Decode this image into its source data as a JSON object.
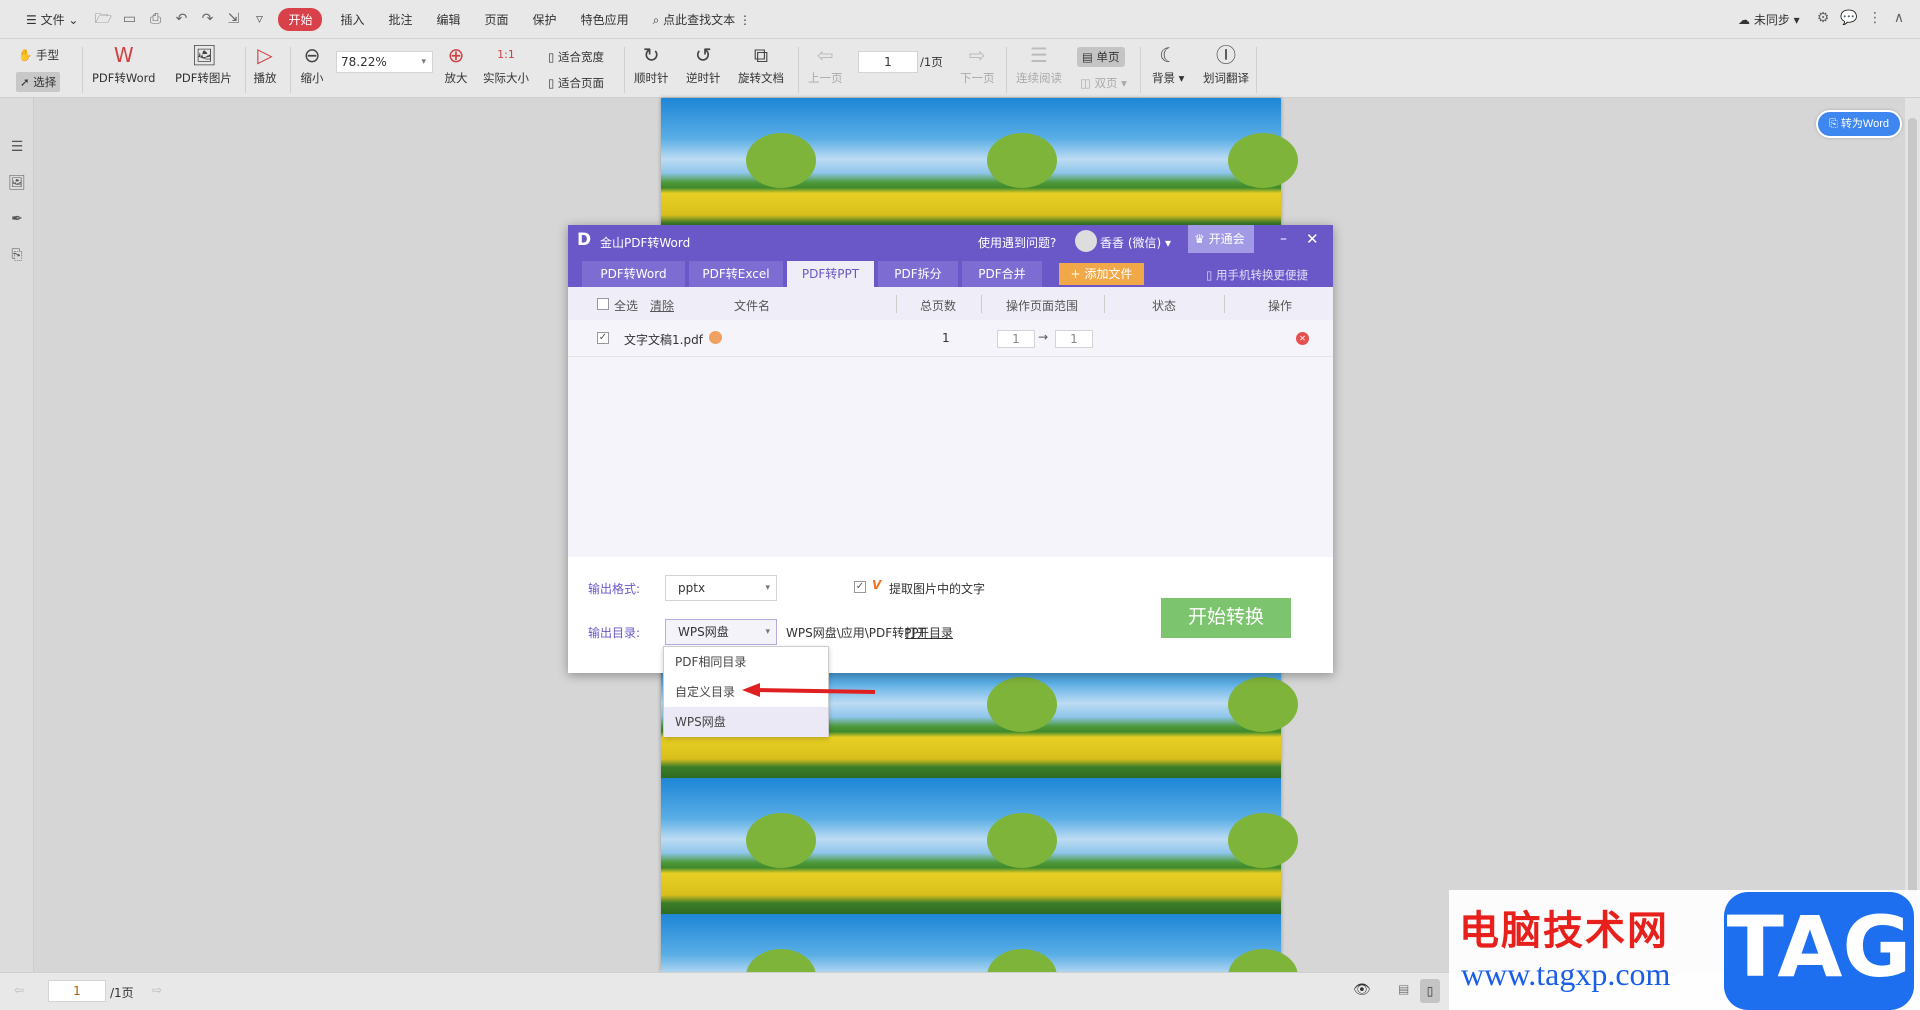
{
  "menubar": {
    "file": "文件",
    "start": "开始",
    "items": [
      "插入",
      "批注",
      "编辑",
      "页面",
      "保护",
      "特色应用"
    ],
    "search": "点此查找文本",
    "sync": "未同步"
  },
  "toolbar": {
    "hand": "手型",
    "select": "选择",
    "pdf_to_word": "PDF转Word",
    "pdf_to_image": "PDF转图片",
    "play": "播放",
    "zoom_out": "缩小",
    "zoom_value": "78.22%",
    "zoom_in": "放大",
    "actual_size": "实际大小",
    "fit_width": "适合宽度",
    "fit_page": "适合页面",
    "clockwise": "顺时针",
    "counter_clockwise": "逆时针",
    "rotate_doc": "旋转文档",
    "prev_page": "上一页",
    "page_input": "1",
    "page_total": "/1页",
    "next_page": "下一页",
    "continuous": "连续阅读",
    "single": "单页",
    "double": "双页",
    "background": "背景",
    "translate": "划词翻译"
  },
  "convert_word_button": "转为Word",
  "dialog": {
    "title": "金山PDF转Word",
    "help": "使用遇到问题?",
    "user": "香香 (微信)",
    "vip": "开通会员",
    "tabs": [
      "PDF转Word",
      "PDF转Excel",
      "PDF转PPT",
      "PDF拆分",
      "PDF合并"
    ],
    "add_file": "添加文件",
    "mobile": "用手机转换更便捷",
    "columns": {
      "select_all": "全选",
      "clear": "清除",
      "filename": "文件名",
      "pages": "总页数",
      "range": "操作页面范围",
      "status": "状态",
      "action": "操作"
    },
    "rows": [
      {
        "filename": "文字文稿1.pdf",
        "pages": "1",
        "from": "1",
        "to": "1",
        "checked": true
      }
    ],
    "output_format_label": "输出格式:",
    "output_format": "pptx",
    "ocr_label": "提取图片中的文字",
    "output_dir_label": "输出目录:",
    "output_dir": "WPS网盘",
    "output_path": "WPS网盘\\应用\\PDF转PPT",
    "open_dir": "打开目录",
    "dir_options": [
      "PDF相同目录",
      "自定义目录",
      "WPS网盘"
    ],
    "start": "开始转换"
  },
  "bottombar": {
    "page_input": "1",
    "page_total": "/1页"
  },
  "watermark": {
    "title": "电脑技术网",
    "url": "www.tagxp.com",
    "logo": "TAG"
  },
  "colors": {
    "accent": "#6a58c8",
    "start_red": "#d8404a",
    "convert_green": "#7dc46f",
    "add_orange": "#f0a848"
  }
}
